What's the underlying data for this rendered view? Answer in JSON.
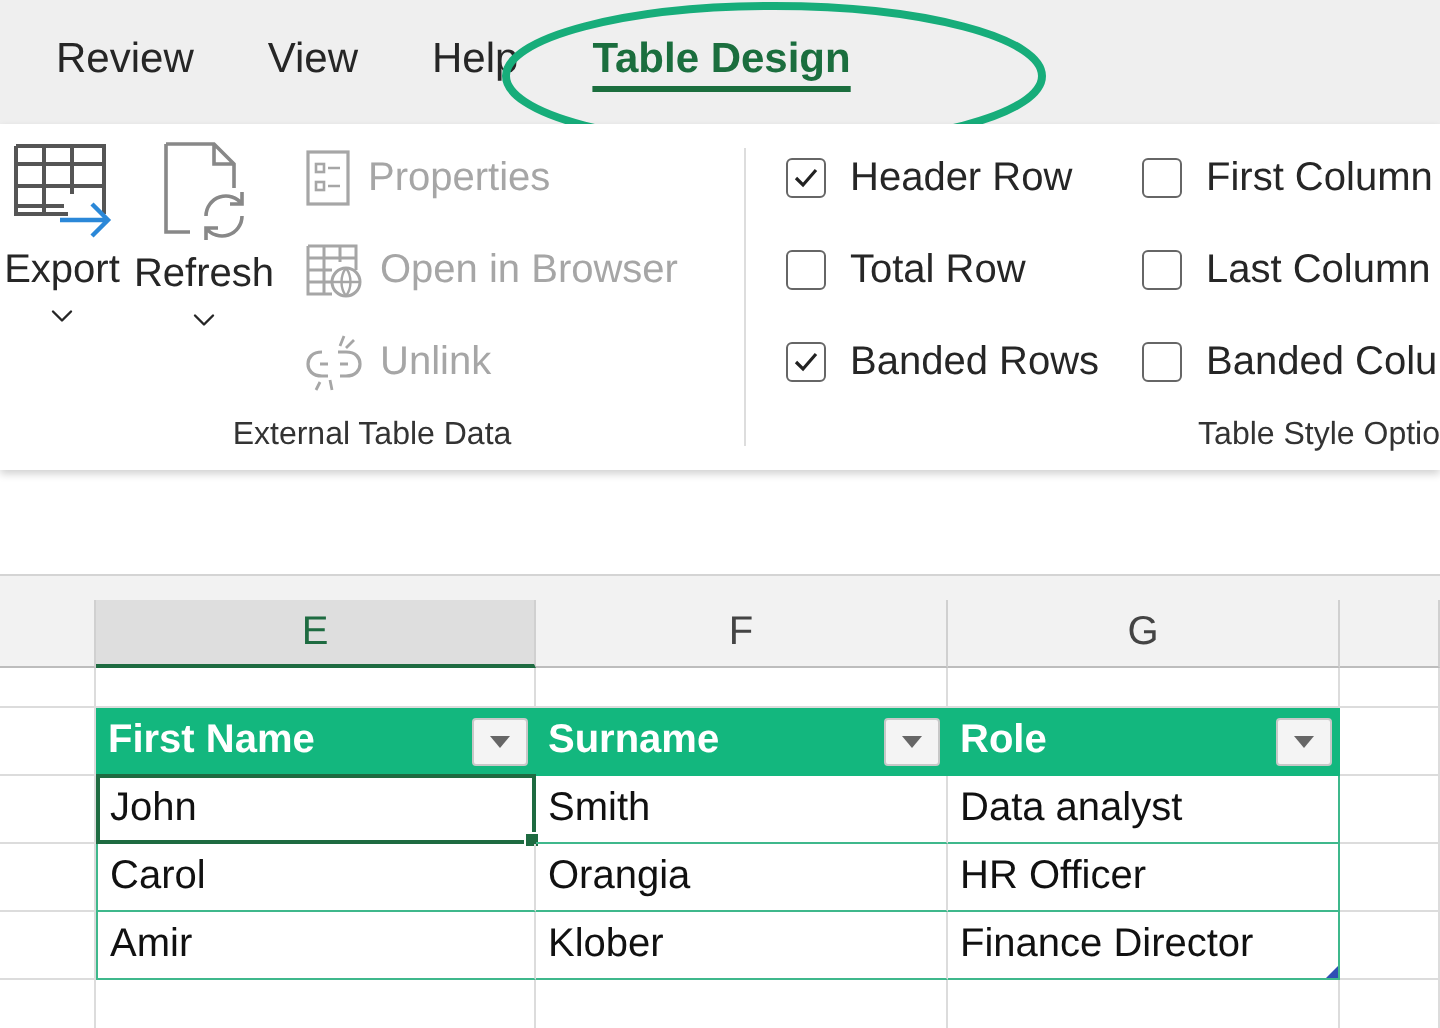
{
  "tabs": [
    {
      "label": "Review",
      "selected": false
    },
    {
      "label": "View",
      "selected": false
    },
    {
      "label": "Help",
      "selected": false
    },
    {
      "label": "Table Design",
      "selected": true
    }
  ],
  "ribbon": {
    "external_group": {
      "label": "External Table Data",
      "large_buttons": [
        {
          "label": "Export"
        },
        {
          "label": "Refresh"
        }
      ],
      "small_buttons": [
        {
          "label": "Properties",
          "disabled": true
        },
        {
          "label": "Open in Browser",
          "disabled": true
        },
        {
          "label": "Unlink",
          "disabled": true
        }
      ]
    },
    "options_group": {
      "label": "Table Style Optio",
      "checkboxes": [
        {
          "label": "Header Row",
          "checked": true
        },
        {
          "label": "Total Row",
          "checked": false
        },
        {
          "label": "Banded Rows",
          "checked": true
        },
        {
          "label": "First Column",
          "checked": false
        },
        {
          "label": "Last Column",
          "checked": false
        },
        {
          "label": "Banded Colu",
          "checked": false
        }
      ]
    }
  },
  "columns": [
    {
      "label": "E",
      "selected": true
    },
    {
      "label": "F",
      "selected": false
    },
    {
      "label": "G",
      "selected": false
    }
  ],
  "table": {
    "headers": [
      "First Name",
      "Surname",
      "Role"
    ],
    "rows": [
      {
        "cells": [
          {
            "text": "John",
            "selected": true
          },
          {
            "text": "Smith",
            "selected": false
          },
          {
            "text": "Data analyst",
            "selected": false
          }
        ]
      },
      {
        "cells": [
          {
            "text": "Carol",
            "selected": false
          },
          {
            "text": "Orangia",
            "selected": false
          },
          {
            "text": "HR Officer",
            "selected": false
          }
        ]
      },
      {
        "cells": [
          {
            "text": "Amir",
            "selected": false
          },
          {
            "text": "Klober",
            "selected": false
          },
          {
            "text": "Finance Director",
            "selected": false
          }
        ]
      }
    ]
  }
}
